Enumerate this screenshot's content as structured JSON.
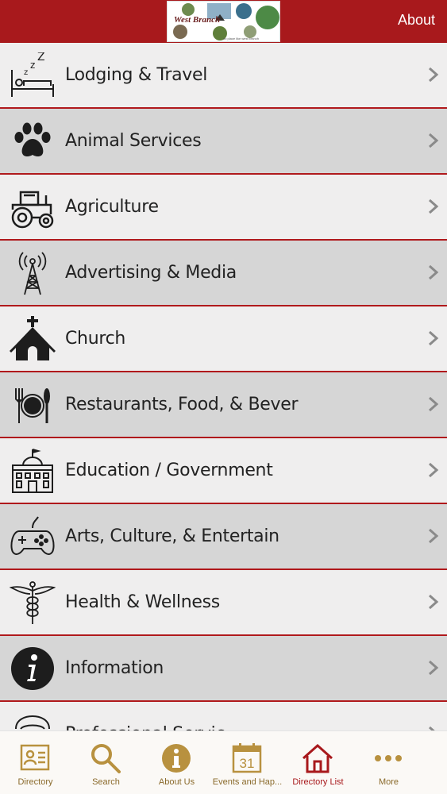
{
  "header": {
    "about_label": "About",
    "brand_color": "#a8191c",
    "logo_text": "West Branch"
  },
  "categories": [
    {
      "label": "Lodging & Travel",
      "icon": "bed-icon"
    },
    {
      "label": "Animal Services",
      "icon": "paw-icon"
    },
    {
      "label": "Agriculture",
      "icon": "tractor-icon"
    },
    {
      "label": "Advertising & Media",
      "icon": "antenna-tower-icon"
    },
    {
      "label": "Church",
      "icon": "church-icon"
    },
    {
      "label": "Restaurants, Food, & Bever",
      "icon": "plate-fork-knife-icon"
    },
    {
      "label": "Education / Government",
      "icon": "government-building-icon"
    },
    {
      "label": "Arts, Culture, & Entertain",
      "icon": "gamepad-icon"
    },
    {
      "label": "Health & Wellness",
      "icon": "caduceus-icon"
    },
    {
      "label": "Information",
      "icon": "info-icon"
    },
    {
      "label": "Professional Servic",
      "icon": "professional-icon"
    }
  ],
  "tabbar": {
    "tabs": [
      {
        "label": "Directory",
        "icon": "directory-card-icon"
      },
      {
        "label": "Search",
        "icon": "search-icon"
      },
      {
        "label": "About Us",
        "icon": "info-circle-icon"
      },
      {
        "label": "Events and Hap...",
        "icon": "calendar-icon"
      },
      {
        "label": "Directory List",
        "icon": "home-icon"
      },
      {
        "label": "More",
        "icon": "more-dots-icon"
      }
    ],
    "calendar_day": "31",
    "active_tab": "Directory List",
    "accent_color": "#b8913f"
  }
}
